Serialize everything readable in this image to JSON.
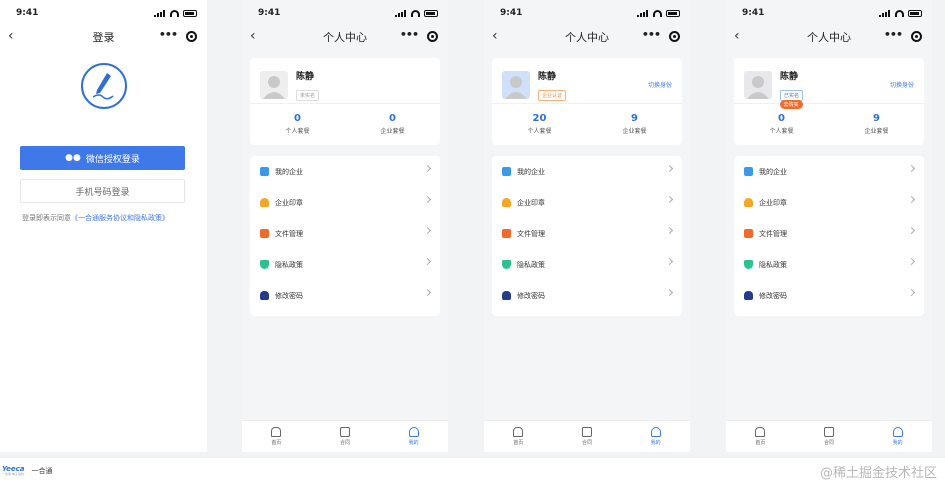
{
  "status_time": "9:41",
  "login": {
    "nav_title": "登录",
    "wechat_btn": "微信授权登录",
    "phone_btn": "手机号码登录",
    "agree_prefix": "登录即表示同意",
    "agree_link": "《一合通服务协议和隐私政策》"
  },
  "profile_nav_title": "个人中心",
  "menu": [
    "我的企业",
    "企业印章",
    "文件管理",
    "隐私政策",
    "修改密码"
  ],
  "tabs": [
    "首页",
    "合同",
    "我的"
  ],
  "screens": [
    {
      "name": "陈静",
      "badge": "未实名",
      "switch_label": "",
      "personal_contracts": "0",
      "enterprise_contracts": "0",
      "personal_label": "个人套餐",
      "enterprise_label": "企业套餐",
      "pin": ""
    },
    {
      "name": "陈静",
      "badge": "企业认证",
      "switch_label": "切换身份",
      "personal_contracts": "20",
      "enterprise_contracts": "9",
      "personal_label": "个人套餐",
      "enterprise_label": "企业套餐",
      "pin": ""
    },
    {
      "name": "陈静",
      "badge": "已实名",
      "switch_label": "切换身份",
      "personal_contracts": "0",
      "enterprise_contracts": "9",
      "personal_label": "个人套餐",
      "enterprise_label": "企业套餐",
      "pin": "去购买"
    }
  ],
  "footer": {
    "brand_logo": "Yeeca",
    "brand_logo_sub": "一合通·电子签约",
    "brand_name": "一合通"
  },
  "watermark": "@稀土掘金技术社区",
  "colors": {
    "primary": "#3f78e8",
    "accent": "#f26b2a"
  }
}
